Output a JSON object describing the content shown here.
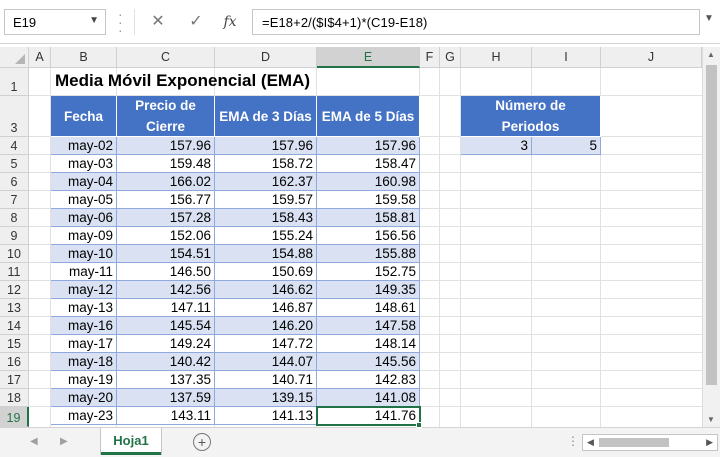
{
  "formula_bar": {
    "name_box": "E19",
    "formula": "=E18+2/($I$4+1)*(C19-E18)",
    "fx_label": "fx",
    "cancel_glyph": "✕",
    "enter_glyph": "✓"
  },
  "columns": [
    "A",
    "B",
    "C",
    "D",
    "E",
    "F",
    "G",
    "H",
    "I",
    "J"
  ],
  "rows": [
    "1",
    "3",
    "4",
    "5",
    "6",
    "7",
    "8",
    "9",
    "10",
    "11",
    "12",
    "13",
    "14",
    "15",
    "16",
    "17",
    "18",
    "19"
  ],
  "active_cell": {
    "column": "E",
    "row": "19"
  },
  "sheet": {
    "title": "Media Móvil Exponencial (EMA)",
    "table": {
      "headers": [
        "Fecha",
        "Precio de Cierre",
        "EMA de 3 Días",
        "EMA de 5 Días"
      ],
      "rows": [
        [
          "may-02",
          "157.96",
          "157.96",
          "157.96"
        ],
        [
          "may-03",
          "159.48",
          "158.72",
          "158.47"
        ],
        [
          "may-04",
          "166.02",
          "162.37",
          "160.98"
        ],
        [
          "may-05",
          "156.77",
          "159.57",
          "159.58"
        ],
        [
          "may-06",
          "157.28",
          "158.43",
          "158.81"
        ],
        [
          "may-09",
          "152.06",
          "155.24",
          "156.56"
        ],
        [
          "may-10",
          "154.51",
          "154.88",
          "155.88"
        ],
        [
          "may-11",
          "146.50",
          "150.69",
          "152.75"
        ],
        [
          "may-12",
          "142.56",
          "146.62",
          "149.35"
        ],
        [
          "may-13",
          "147.11",
          "146.87",
          "148.61"
        ],
        [
          "may-16",
          "145.54",
          "146.20",
          "147.58"
        ],
        [
          "may-17",
          "149.24",
          "147.72",
          "148.14"
        ],
        [
          "may-18",
          "140.42",
          "144.07",
          "145.56"
        ],
        [
          "may-19",
          "137.35",
          "140.71",
          "142.83"
        ],
        [
          "may-20",
          "137.59",
          "139.15",
          "141.08"
        ],
        [
          "may-23",
          "143.11",
          "141.13",
          "141.76"
        ]
      ]
    },
    "periods": {
      "header": "Número de Periodos",
      "values": [
        "3",
        "5"
      ]
    }
  },
  "tabs": {
    "sheet_name": "Hoja1",
    "add_glyph": "+"
  },
  "colors": {
    "header_blue": "#4472c4",
    "band_blue": "#d9e1f2",
    "excel_green": "#217346"
  }
}
